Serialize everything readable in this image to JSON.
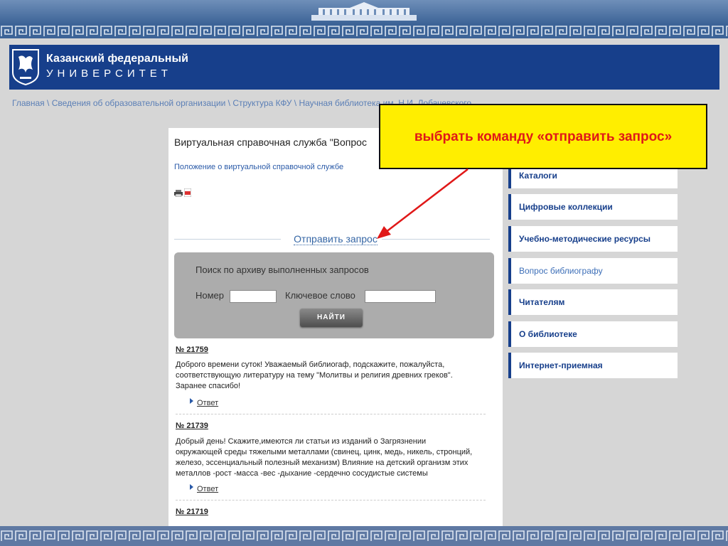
{
  "header": {
    "university_line1": "Казанский федеральный",
    "university_line2": "УНИВЕРСИТЕТ"
  },
  "breadcrumb": {
    "items": [
      "Главная",
      "Сведения об образовательной организации",
      "Структура КФУ",
      "Научная библиотека им. Н.И. Лобачевского"
    ],
    "separator": " \\ "
  },
  "main": {
    "title": "Виртуальная справочная служба \"Вопрос",
    "regulation_link": "Положение о виртуальной справочной службе",
    "send_request": "Отправить запрос",
    "search": {
      "title": "Поиск по архиву выполненных запросов",
      "number_label": "Номер",
      "keyword_label": "Ключевое слово",
      "number_value": "",
      "keyword_value": "",
      "button_label": "НАЙТИ"
    },
    "entries": [
      {
        "number": "№ 21759",
        "text": "Доброго времени суток! Уважаемый библиогаф, подскажите, пожалуйста, соответствующую литературу на тему \"Молитвы и религия древних греков\". Заранее спасибо!",
        "answer": "Ответ"
      },
      {
        "number": "№ 21739",
        "text": "Добрый день! Скажите,имеются ли статьи из изданий о Загрязнении окружающей среды тяжелыми металлами (свинец, цинк, медь, никель, стронций, железо, эссенциальный полезный механизм) Влияние на детский организм этих металлов -рост -масса -вес -дыхание -сердечно сосудистые системы",
        "answer": "Ответ"
      },
      {
        "number": "№ 21719"
      }
    ]
  },
  "sidebar": {
    "items": [
      {
        "label": "Каталоги"
      },
      {
        "label": "Цифровые коллекции"
      },
      {
        "label": "Учебно-методические ресурсы"
      },
      {
        "label": "Вопрос библиографу"
      },
      {
        "label": "Читателям"
      },
      {
        "label": "О библиотеке"
      },
      {
        "label": "Интернет-приемная"
      }
    ]
  },
  "callout": {
    "text": "выбрать команду «отправить запрос»"
  },
  "colors": {
    "header_blue": "#173f8b",
    "link_blue": "#3566a5",
    "callout_yellow": "#ffee00",
    "callout_text_red": "#e01818",
    "arrow_red": "#e01818"
  }
}
